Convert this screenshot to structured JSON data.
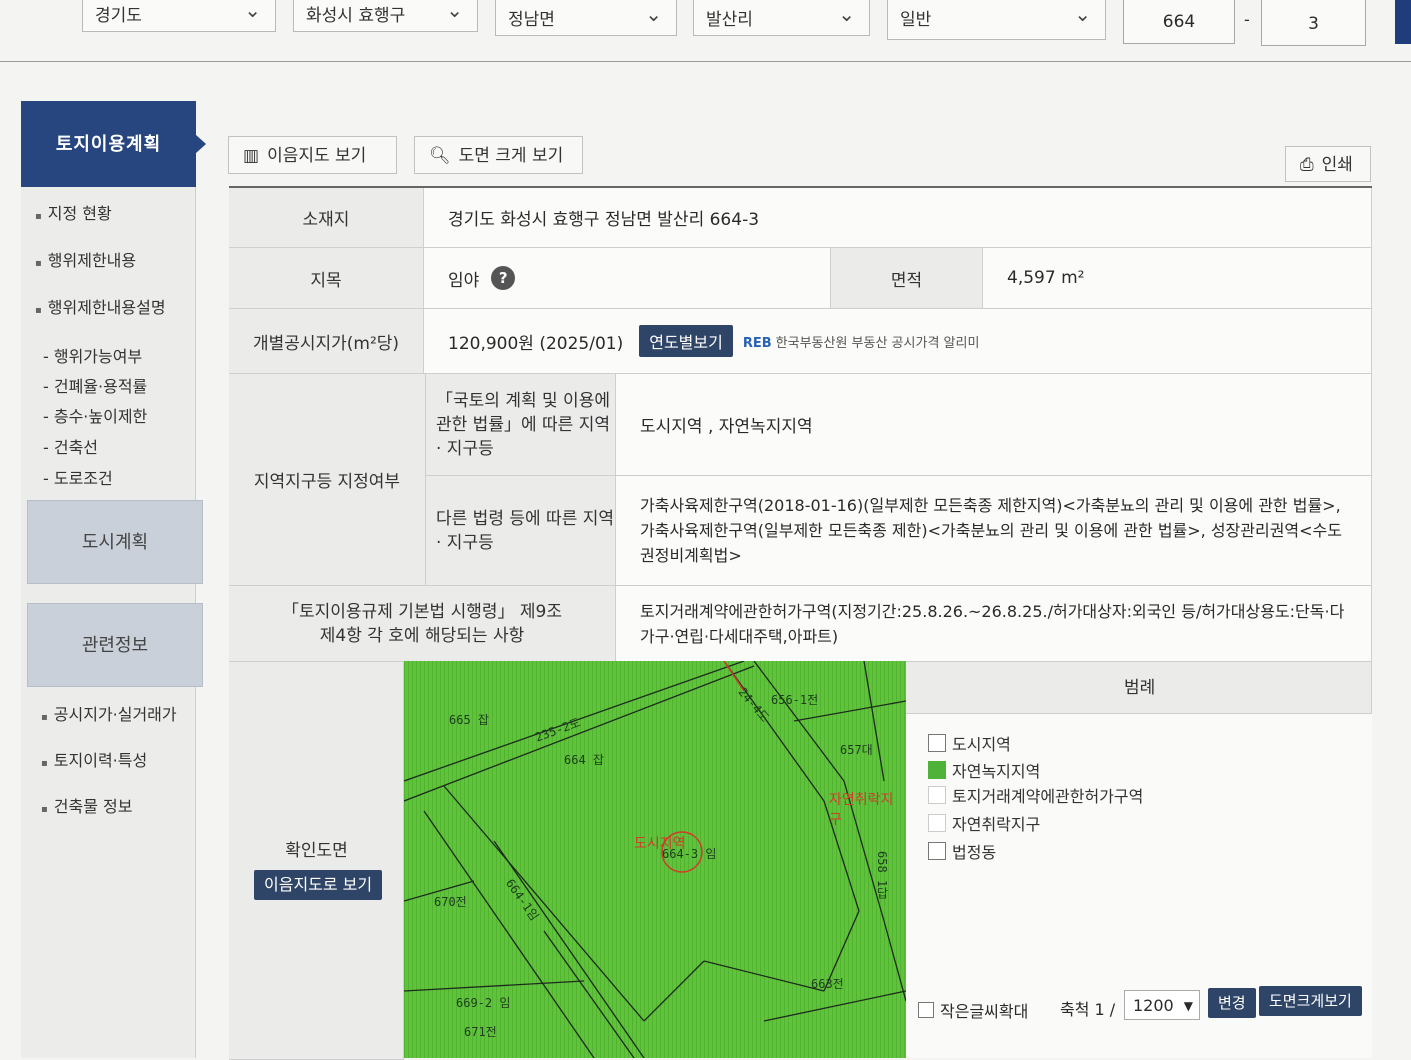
{
  "filters": {
    "province": "경기도",
    "city": "화성시 효행구",
    "town": "정남면",
    "village": "발산리",
    "land_type": "일반",
    "main_no": "664",
    "separator": "-",
    "sub_no": "3"
  },
  "sidebar": {
    "title": "토지이용계획",
    "items": [
      "지정 현황",
      "행위제한내용",
      "행위제한내용설명"
    ],
    "subitems": [
      "- 행위가능여부",
      "- 건폐율·용적률",
      "- 층수·높이제한",
      "- 건축선",
      "- 도로조건"
    ],
    "block1": "도시계획",
    "block2": "관련정보",
    "items2": [
      "공시지가·실거래가",
      "토지이력·특성",
      "건축물 정보"
    ]
  },
  "toolbar": {
    "map_btn": "이음지도 보기",
    "zoom_btn": "도면 크게 보기",
    "print_btn": "인쇄"
  },
  "info": {
    "location_label": "소재지",
    "location_value": "경기도 화성시 효행구 정남면 발산리 664-3",
    "category_label": "지목",
    "category_value": "임야",
    "help": "?",
    "area_label": "면적",
    "area_value": "4,597 m²",
    "price_label": "개별공시지가(m²당)",
    "price_value": "120,900원 (2025/01)",
    "year_btn": "연도별보기",
    "reb_logo": "REB",
    "reb_text": "한국부동산원 부동산 공시가격 알리미",
    "zone_label": "지역지구등 지정여부",
    "zone_sub1_label": "「국토의 계획 및 이용에 관한 법률」에 따른 지역 · 지구등",
    "zone_sub1_value": "도시지역 , 자연녹지지역",
    "zone_sub2_label": "다른 법령 등에 따른 지역 · 지구등",
    "zone_sub2_value": "가축사육제한구역(2018-01-16)(일부제한 모든축종 제한지역)<가축분뇨의 관리 및 이용에 관한 법률>, 가축사육제한구역(일부제한 모든축종 제한)<가축분뇨의 관리 및 이용에 관한 법률>, 성장관리권역<수도권정비계획법>",
    "act_label": "「토지이용규제 기본법 시행령」 제9조 제4항 각 호에 해당되는 사항",
    "act_value": "토지거래계약에관한허가구역(지정기간:25.8.26.~26.8.25./허가대상자:외국인 등/허가대상용도:단독·다가구·연립·다세대주택,아파트)",
    "map_label": "확인도면",
    "map_btn2": "이음지도로 보기"
  },
  "map_labels": {
    "l665": "665 잡",
    "l664": "664 잡",
    "l656": "656-1전",
    "l657": "657대",
    "l658": "658 1답",
    "l670": "670전",
    "l664_1": "664-1임",
    "l669": "669-2 임",
    "l671": "671전",
    "l663": "663전",
    "city_zone": "도시지역",
    "natural_village": "자연취락지구",
    "target": "664-3 임",
    "road1": "235-2도",
    "road2": "24-4도"
  },
  "legend": {
    "title": "범례",
    "items": [
      {
        "label": "도시지역",
        "color": "#ffffff"
      },
      {
        "label": "자연녹지지역",
        "color": "#4fb33a"
      },
      {
        "label": "토지거래계약에관한허가구역",
        "color": "#ffffff"
      },
      {
        "label": "자연취락지구",
        "color": "#ffffff"
      },
      {
        "label": "법정동",
        "color": "#ffffff"
      }
    ]
  },
  "map_controls": {
    "small_text": "작은글씨확대",
    "scale_label": "축척 1 /",
    "scale_value": "1200",
    "change_btn": "변경",
    "zoom_btn": "도면크게보기"
  }
}
